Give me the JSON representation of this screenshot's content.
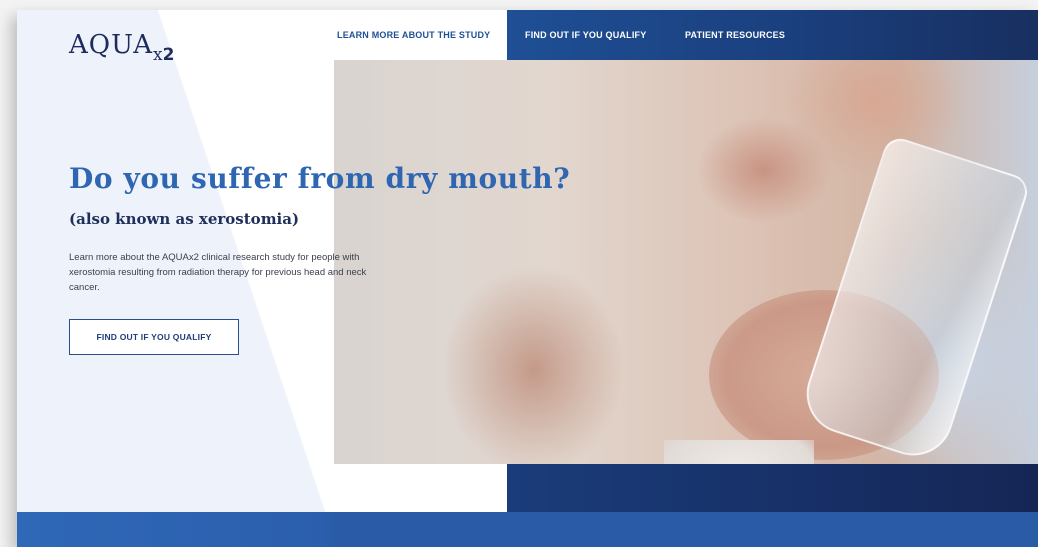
{
  "brand": {
    "logo_main": "AQUA",
    "logo_x": "x",
    "logo_num": "2"
  },
  "nav": {
    "items": [
      {
        "label": "LEARN MORE ABOUT THE STUDY"
      },
      {
        "label": "FIND OUT IF YOU QUALIFY"
      },
      {
        "label": "PATIENT RESOURCES"
      }
    ]
  },
  "hero": {
    "title": "Do you suffer from dry mouth?",
    "subtitle": "(also known as xerostomia)",
    "body": "Learn more about the AQUAx2 clinical research study for people with xerostomia resulting from radiation therapy for previous head and neck cancer.",
    "cta_label": "FIND OUT IF YOU QUALIFY"
  },
  "colors": {
    "primary_blue": "#2e66b2",
    "navy": "#1d2c5c",
    "nav_bg": "#1f4f95"
  }
}
